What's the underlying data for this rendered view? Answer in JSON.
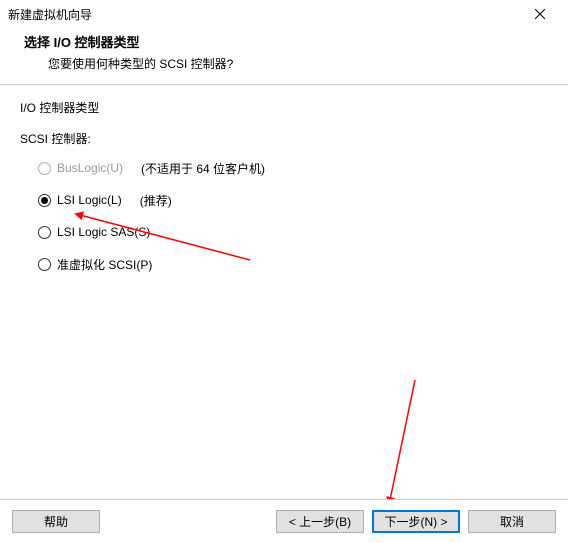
{
  "window": {
    "title": "新建虚拟机向导"
  },
  "header": {
    "title": "选择 I/O 控制器类型",
    "subtitle": "您要使用何种类型的 SCSI 控制器?"
  },
  "content": {
    "group_title": "I/O 控制器类型",
    "sub_title": "SCSI 控制器:",
    "options": [
      {
        "label": "BusLogic(U)",
        "note": "(不适用于 64 位客户机)",
        "disabled": true,
        "selected": false
      },
      {
        "label": "LSI Logic(L)",
        "note": "(推荐)",
        "disabled": false,
        "selected": true
      },
      {
        "label": "LSI Logic SAS(S)",
        "note": "",
        "disabled": false,
        "selected": false
      },
      {
        "label": "准虚拟化 SCSI(P)",
        "note": "",
        "disabled": false,
        "selected": false
      }
    ]
  },
  "buttons": {
    "help": "帮助",
    "back": "< 上一步(B)",
    "next": "下一步(N) >",
    "cancel": "取消"
  }
}
